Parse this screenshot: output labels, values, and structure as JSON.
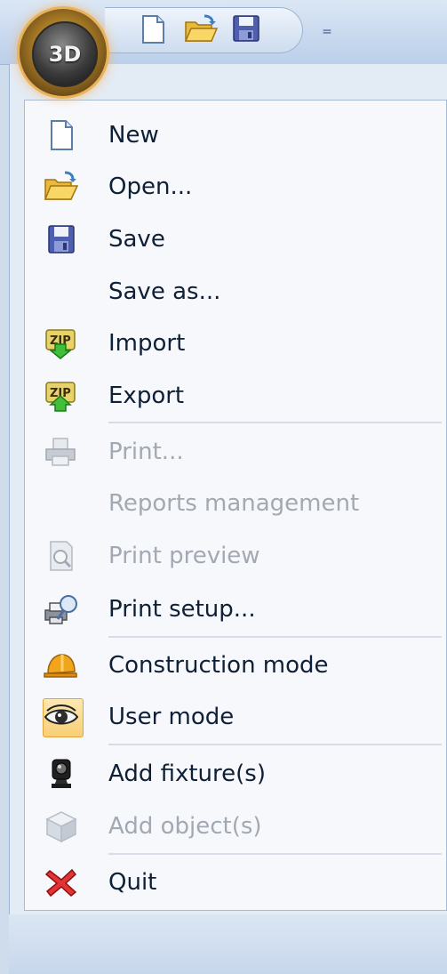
{
  "app": {
    "button_label": "3D"
  },
  "quick_access": {
    "items": [
      {
        "icon": "new-document-icon"
      },
      {
        "icon": "open-folder-icon"
      },
      {
        "icon": "save-disk-icon"
      }
    ],
    "customize_glyph": "="
  },
  "menu": {
    "items": [
      {
        "label": "New",
        "icon": "new-document-icon",
        "enabled": true
      },
      {
        "label": "Open...",
        "icon": "open-folder-icon",
        "enabled": true
      },
      {
        "label": "Save",
        "icon": "save-disk-icon",
        "enabled": true
      },
      {
        "label": "Save as...",
        "icon": "",
        "enabled": true
      },
      {
        "label": "Import",
        "icon": "import-zip-icon",
        "enabled": true
      },
      {
        "label": "Export",
        "icon": "export-zip-icon",
        "enabled": true
      },
      {
        "label": "Print...",
        "icon": "printer-icon",
        "enabled": false
      },
      {
        "label": "Reports management",
        "icon": "",
        "enabled": false
      },
      {
        "label": "Print preview",
        "icon": "print-preview-icon",
        "enabled": false
      },
      {
        "label": "Print setup...",
        "icon": "print-setup-icon",
        "enabled": true
      },
      {
        "label": "Construction mode",
        "icon": "hard-hat-icon",
        "enabled": true
      },
      {
        "label": "User mode",
        "icon": "eye-icon",
        "enabled": true,
        "checked": true
      },
      {
        "label": "Add fixture(s)",
        "icon": "fixture-icon",
        "enabled": true
      },
      {
        "label": "Add object(s)",
        "icon": "cube-icon",
        "enabled": false
      },
      {
        "label": "Quit",
        "icon": "close-x-icon",
        "enabled": true
      }
    ]
  },
  "colors": {
    "highlight": "#f8cf74",
    "disabled_text": "#a3a9b3",
    "text": "#0f1f36"
  }
}
